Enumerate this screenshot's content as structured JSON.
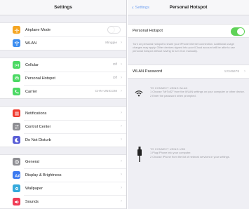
{
  "settings": {
    "title": "Settings",
    "groups": [
      [
        {
          "label": "Airplane Mode",
          "icon": "airplane-icon",
          "color": "#f5a623",
          "control": "toggle-off"
        },
        {
          "label": "WLAN",
          "icon": "wifi-icon",
          "color": "#3d8ef0",
          "value": "Mingpie"
        }
      ],
      [
        {
          "label": "Cellular",
          "icon": "cellular-icon",
          "color": "#4cd964",
          "value": "Off"
        },
        {
          "label": "Personal Hotspot",
          "icon": "hotspot-icon",
          "color": "#4cd964",
          "value": "Off"
        },
        {
          "label": "Carrier",
          "icon": "phone-icon",
          "color": "#4cd964",
          "value": "CHN-UNICOM"
        }
      ],
      [
        {
          "label": "Notifications",
          "icon": "notifications-icon",
          "color": "#f03b30"
        },
        {
          "label": "Control Center",
          "icon": "control-center-icon",
          "color": "#8e8e93"
        },
        {
          "label": "Do Not Disturb",
          "icon": "moon-icon",
          "color": "#5a5fd6"
        }
      ],
      [
        {
          "label": "General",
          "icon": "gear-icon",
          "color": "#8e8e93"
        },
        {
          "label": "Display & Brightness",
          "icon": "display-icon",
          "color": "#3d7bf0"
        },
        {
          "label": "Wallpaper",
          "icon": "wallpaper-icon",
          "color": "#35aadc"
        },
        {
          "label": "Sounds",
          "icon": "sound-icon",
          "color": "#f03b55"
        }
      ]
    ]
  },
  "hotspot": {
    "back_label": "Settings",
    "title": "Personal Hotspot",
    "toggle_label": "Personal Hotspot",
    "toggle_on": true,
    "note": "Turn on personal hotspot to share your iPhone internet connection. Additional usage charges may apply. Other devices signed into your iCloud account will be able to use personal hotspot without having to turn it on manually.",
    "password_label": "WLAN Password",
    "password_value": "12345678",
    "wlan": {
      "heading": "TO CONNECT USING WLAN",
      "step1": "1 Choose \"MrTo52\" from the WLAN settings on your computer or other device.",
      "step2": "2 Enter the password when prompted."
    },
    "usb": {
      "heading": "TO CONNECT USING USB",
      "step1": "1 Plug iPhone into your computer.",
      "step2": "2 Choose iPhone from the list of network services in your settings."
    }
  }
}
